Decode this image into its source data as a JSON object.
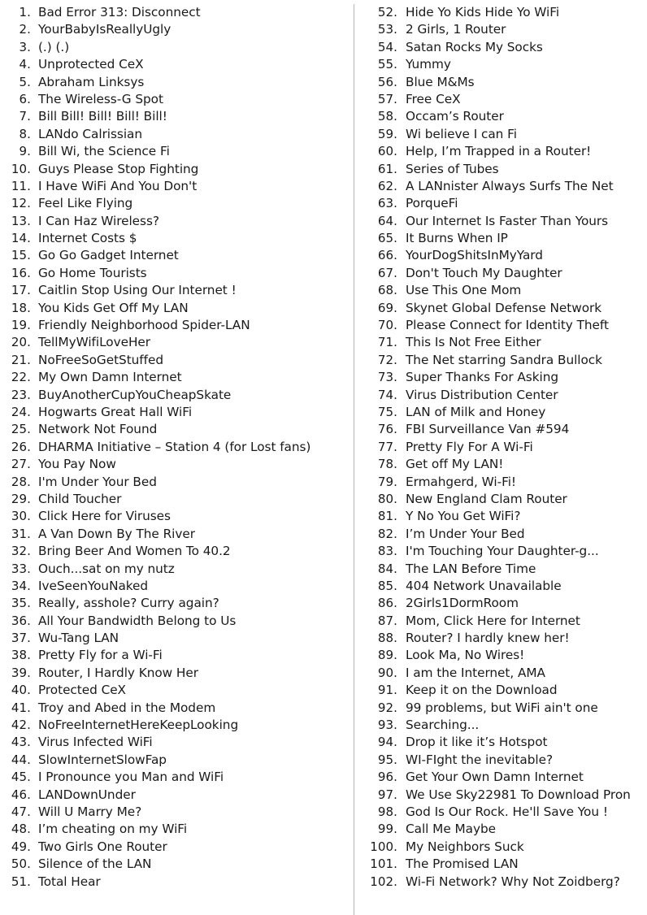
{
  "page": {
    "background_color": "#ffffff",
    "text_color": "#1a1a1a",
    "divider_color": "#b4b4b4"
  },
  "list": {
    "total_items": 102,
    "columns": [
      {
        "name": "left-column",
        "start_number": 1,
        "end_number": 51,
        "items": [
          {
            "number": "1.",
            "text": "Bad Error 313: Disconnect"
          },
          {
            "number": "2.",
            "text": "YourBabyIsReallyUgly"
          },
          {
            "number": "3.",
            "text": "(.) (.)"
          },
          {
            "number": "4.",
            "text": "Unprotected CeX"
          },
          {
            "number": "5.",
            "text": "Abraham Linksys"
          },
          {
            "number": "6.",
            "text": "The Wireless-G Spot"
          },
          {
            "number": "7.",
            "text": "Bill Bill! Bill! Bill! Bill!"
          },
          {
            "number": "8.",
            "text": "LANdo Calrissian"
          },
          {
            "number": "9.",
            "text": "Bill Wi, the Science Fi"
          },
          {
            "number": "10.",
            "text": "Guys Please Stop Fighting"
          },
          {
            "number": "11.",
            "text": "I Have WiFi And You Don't"
          },
          {
            "number": "12.",
            "text": "Feel Like Flying"
          },
          {
            "number": "13.",
            "text": "I Can Haz Wireless?"
          },
          {
            "number": "14.",
            "text": "Internet Costs $"
          },
          {
            "number": "15.",
            "text": "Go Go Gadget Internet"
          },
          {
            "number": "16.",
            "text": "Go Home Tourists"
          },
          {
            "number": "17.",
            "text": "Caitlin Stop Using Our Internet !"
          },
          {
            "number": "18.",
            "text": "You Kids Get Off My LAN"
          },
          {
            "number": "19.",
            "text": "Friendly Neighborhood Spider-LAN"
          },
          {
            "number": "20.",
            "text": "TellMyWifiLoveHer"
          },
          {
            "number": "21.",
            "text": "NoFreeSoGetStuffed"
          },
          {
            "number": "22.",
            "text": "My Own Damn Internet"
          },
          {
            "number": "23.",
            "text": "BuyAnotherCupYouCheapSkate"
          },
          {
            "number": "24.",
            "text": "Hogwarts Great Hall WiFi"
          },
          {
            "number": "25.",
            "text": "Network Not Found"
          },
          {
            "number": "26.",
            "text": "DHARMA Initiative – Station 4 (for Lost fans)"
          },
          {
            "number": "27.",
            "text": "You Pay Now"
          },
          {
            "number": "28.",
            "text": "I'm Under Your Bed"
          },
          {
            "number": "29.",
            "text": "Child Toucher"
          },
          {
            "number": "30.",
            "text": "Click Here for Viruses"
          },
          {
            "number": "31.",
            "text": "A Van Down By The River"
          },
          {
            "number": "32.",
            "text": "Bring Beer And Women To 40.2"
          },
          {
            "number": "33.",
            "text": "Ouch...sat on my nutz"
          },
          {
            "number": "34.",
            "text": "IveSeenYouNaked"
          },
          {
            "number": "35.",
            "text": "Really, asshole? Curry again?"
          },
          {
            "number": "36.",
            "text": "All Your Bandwidth Belong to Us"
          },
          {
            "number": "37.",
            "text": "Wu-Tang LAN"
          },
          {
            "number": "38.",
            "text": "Pretty Fly for a Wi-Fi"
          },
          {
            "number": "39.",
            "text": "Router, I Hardly Know Her"
          },
          {
            "number": "40.",
            "text": "Protected CeX"
          },
          {
            "number": "41.",
            "text": "Troy and Abed in the Modem"
          },
          {
            "number": "42.",
            "text": "NoFreeInternetHereKeepLooking"
          },
          {
            "number": "43.",
            "text": "Virus Infected WiFi"
          },
          {
            "number": "44.",
            "text": "SlowInternetSlowFap"
          },
          {
            "number": "45.",
            "text": "I Pronounce you Man and WiFi"
          },
          {
            "number": "46.",
            "text": "LANDownUnder"
          },
          {
            "number": "47.",
            "text": "Will U Marry Me?"
          },
          {
            "number": "48.",
            "text": "I’m cheating on my WiFi"
          },
          {
            "number": "49.",
            "text": "Two Girls One Router"
          },
          {
            "number": "50.",
            "text": "Silence of the LAN"
          },
          {
            "number": "51.",
            "text": "Total Hear"
          }
        ]
      },
      {
        "name": "right-column",
        "start_number": 52,
        "end_number": 102,
        "items": [
          {
            "number": "52.",
            "text": "Hide Yo Kids Hide Yo WiFi"
          },
          {
            "number": "53.",
            "text": "2 Girls, 1 Router"
          },
          {
            "number": "54.",
            "text": "Satan Rocks My Socks"
          },
          {
            "number": "55.",
            "text": "Yummy"
          },
          {
            "number": "56.",
            "text": "Blue M&Ms"
          },
          {
            "number": "57.",
            "text": "Free CeX"
          },
          {
            "number": "58.",
            "text": "Occam’s Router"
          },
          {
            "number": "59.",
            "text": "Wi believe I can Fi"
          },
          {
            "number": "60.",
            "text": "Help, I’m Trapped in a Router!"
          },
          {
            "number": "61.",
            "text": "Series of Tubes"
          },
          {
            "number": "62.",
            "text": "A LANnister Always Surfs The Net"
          },
          {
            "number": "63.",
            "text": "PorqueFi"
          },
          {
            "number": "64.",
            "text": "Our Internet Is Faster Than Yours"
          },
          {
            "number": "65.",
            "text": "It Burns When IP"
          },
          {
            "number": "66.",
            "text": "YourDogShitsInMyYard"
          },
          {
            "number": "67.",
            "text": "Don't Touch My Daughter"
          },
          {
            "number": "68.",
            "text": "Use This One Mom"
          },
          {
            "number": "69.",
            "text": "Skynet Global Defense Network"
          },
          {
            "number": "70.",
            "text": "Please Connect for Identity Theft"
          },
          {
            "number": "71.",
            "text": "This Is Not Free Either"
          },
          {
            "number": "72.",
            "text": "The Net starring Sandra Bullock"
          },
          {
            "number": "73.",
            "text": "Super Thanks For Asking"
          },
          {
            "number": "74.",
            "text": "Virus Distribution Center"
          },
          {
            "number": "75.",
            "text": "LAN of Milk and Honey"
          },
          {
            "number": "76.",
            "text": "FBI Surveillance Van #594"
          },
          {
            "number": "77.",
            "text": "Pretty Fly For A Wi-Fi"
          },
          {
            "number": "78.",
            "text": "Get off My LAN!"
          },
          {
            "number": "79.",
            "text": "Ermahgerd, Wi-Fi!"
          },
          {
            "number": "80.",
            "text": "New England Clam Router"
          },
          {
            "number": "81.",
            "text": "Y No You Get WiFi?"
          },
          {
            "number": "82.",
            "text": "I’m Under Your Bed"
          },
          {
            "number": "83.",
            "text": "I'm Touching Your Daughter-g..."
          },
          {
            "number": "84.",
            "text": "The LAN Before Time"
          },
          {
            "number": "85.",
            "text": "404 Network Unavailable"
          },
          {
            "number": "86.",
            "text": "2Girls1DormRoom"
          },
          {
            "number": "87.",
            "text": "Mom, Click Here for Internet"
          },
          {
            "number": "88.",
            "text": "Router? I hardly knew her!"
          },
          {
            "number": "89.",
            "text": "Look Ma, No Wires!"
          },
          {
            "number": "90.",
            "text": "I am the Internet, AMA"
          },
          {
            "number": "91.",
            "text": "Keep it on the Download"
          },
          {
            "number": "92.",
            "text": "99 problems, but WiFi ain't one"
          },
          {
            "number": "93.",
            "text": "Searching..."
          },
          {
            "number": "94.",
            "text": "Drop it like it’s Hotspot"
          },
          {
            "number": "95.",
            "text": "WI-FIght the inevitable?"
          },
          {
            "number": "96.",
            "text": "Get Your Own Damn Internet"
          },
          {
            "number": "97.",
            "text": "We Use Sky22981 To Download Pron"
          },
          {
            "number": "98.",
            "text": "God Is Our Rock. He'll Save You !"
          },
          {
            "number": "99.",
            "text": "Call Me Maybe"
          },
          {
            "number": "100.",
            "text": "My Neighbors Suck"
          },
          {
            "number": "101.",
            "text": "The Promised LAN"
          },
          {
            "number": "102.",
            "text": "Wi-Fi Network? Why Not Zoidberg?"
          }
        ]
      }
    ]
  }
}
